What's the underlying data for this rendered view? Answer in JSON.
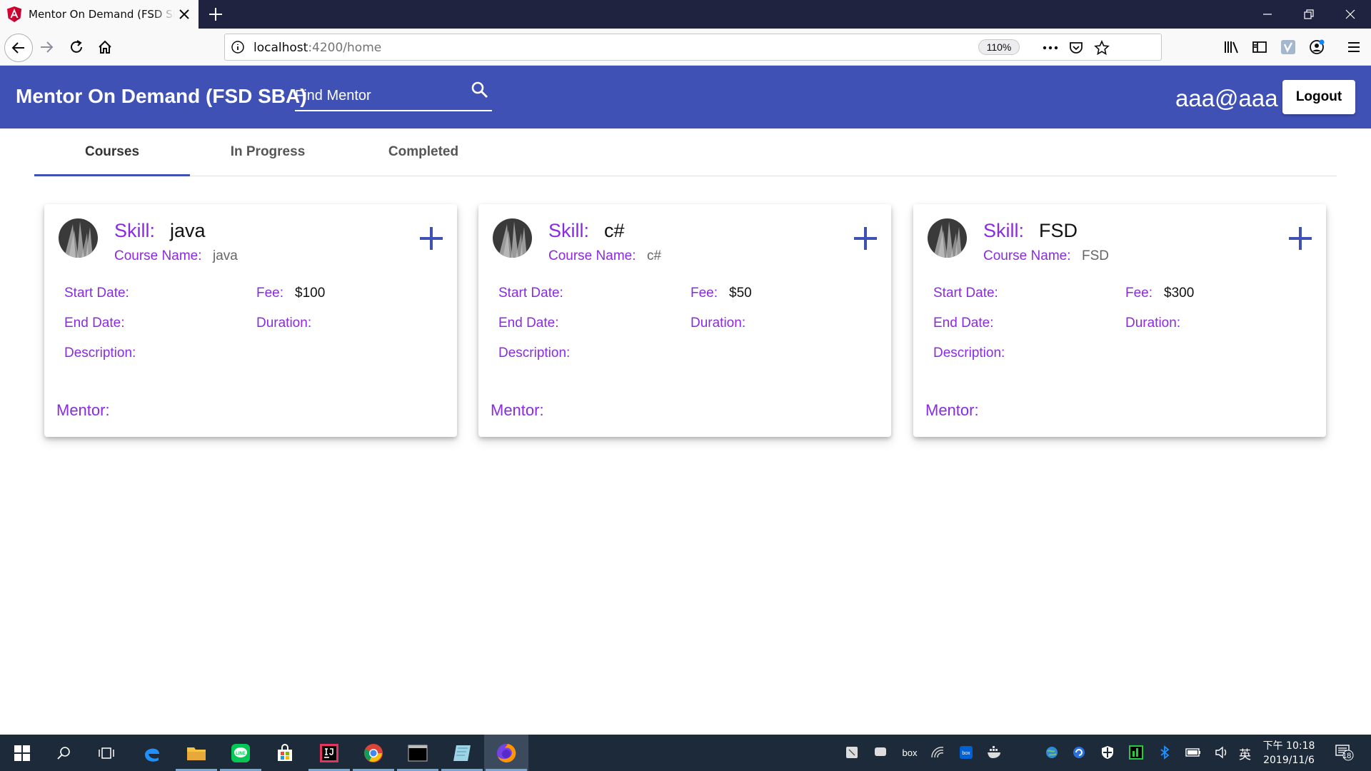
{
  "browser": {
    "tab_title": "Mentor On Demand (FSD SBA)",
    "url_host": "localhost",
    "url_path": ":4200/home",
    "zoom": "110%"
  },
  "app": {
    "title": "Mentor On Demand (FSD SBA)",
    "search_placeholder": "Find Mentor",
    "user_email": "aaa@aaa",
    "logout_label": "Logout"
  },
  "tabs": [
    {
      "label": "Courses",
      "active": true
    },
    {
      "label": "In Progress",
      "active": false
    },
    {
      "label": "Completed",
      "active": false
    }
  ],
  "labels": {
    "skill": "Skill:",
    "course_name": "Course Name:",
    "start_date": "Start Date:",
    "end_date": "End Date:",
    "fee": "Fee:",
    "duration": "Duration:",
    "description": "Description:",
    "mentor": "Mentor:"
  },
  "courses": [
    {
      "skill": "java",
      "course_name": "java",
      "fee": "$100",
      "start_date": "",
      "end_date": "",
      "duration": "",
      "description": "",
      "mentor": ""
    },
    {
      "skill": "c#",
      "course_name": "c#",
      "fee": "$50",
      "start_date": "",
      "end_date": "",
      "duration": "",
      "description": "",
      "mentor": ""
    },
    {
      "skill": "FSD",
      "course_name": "FSD",
      "fee": "$300",
      "start_date": "",
      "end_date": "",
      "duration": "",
      "description": "",
      "mentor": ""
    }
  ],
  "taskbar": {
    "time": "下午 10:18",
    "date": "2019/11/6",
    "ime": "英",
    "notification_count": "18"
  },
  "colors": {
    "primary": "#3f51b5",
    "label_purple": "#8a2be2",
    "browser_chrome": "#202340",
    "taskbar": "#1d2a3a"
  }
}
